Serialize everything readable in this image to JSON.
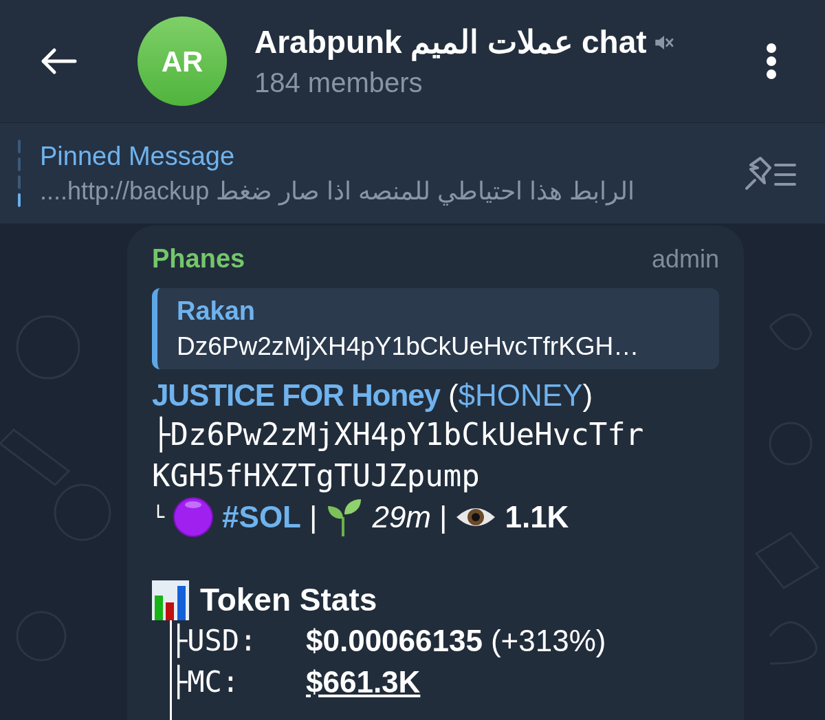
{
  "header": {
    "avatar_initials": "AR",
    "title": "Arabpunk عملات الميم chat",
    "muted": true,
    "subtitle": "184 members"
  },
  "pinned": {
    "label": "Pinned Message",
    "text": "الرابط هذا احتياطي للمنصه اذا صار ضغط http://backup...."
  },
  "message": {
    "sender": "Phanes",
    "role": "admin",
    "reply": {
      "name": "Rakan",
      "text": "Dz6Pw2zMjXH4pY1bCkUeHvcTfrKGH…"
    },
    "token_name": "JUSTICE FOR Honey",
    "ticker_open": "(",
    "ticker": "$HONEY",
    "ticker_close": ")",
    "address_lines": [
      "├Dz6Pw2zMjXH4pY1bCkUeHvcTfr",
      "KGH5fHXZTgTUJZpump"
    ],
    "meta": {
      "prefix": "└",
      "chain": "#SOL",
      "sep1": "|",
      "age": "29m",
      "sep2": "|",
      "views": "1.1K"
    },
    "stats_title": "Token Stats",
    "stats": [
      {
        "prefix": "├",
        "label": "USD:",
        "value": "$0.00066135",
        "change": "(+313%)",
        "kind": "plain"
      },
      {
        "prefix": "├",
        "label": "MC:",
        "value": "$661.3K",
        "kind": "link"
      }
    ]
  }
}
